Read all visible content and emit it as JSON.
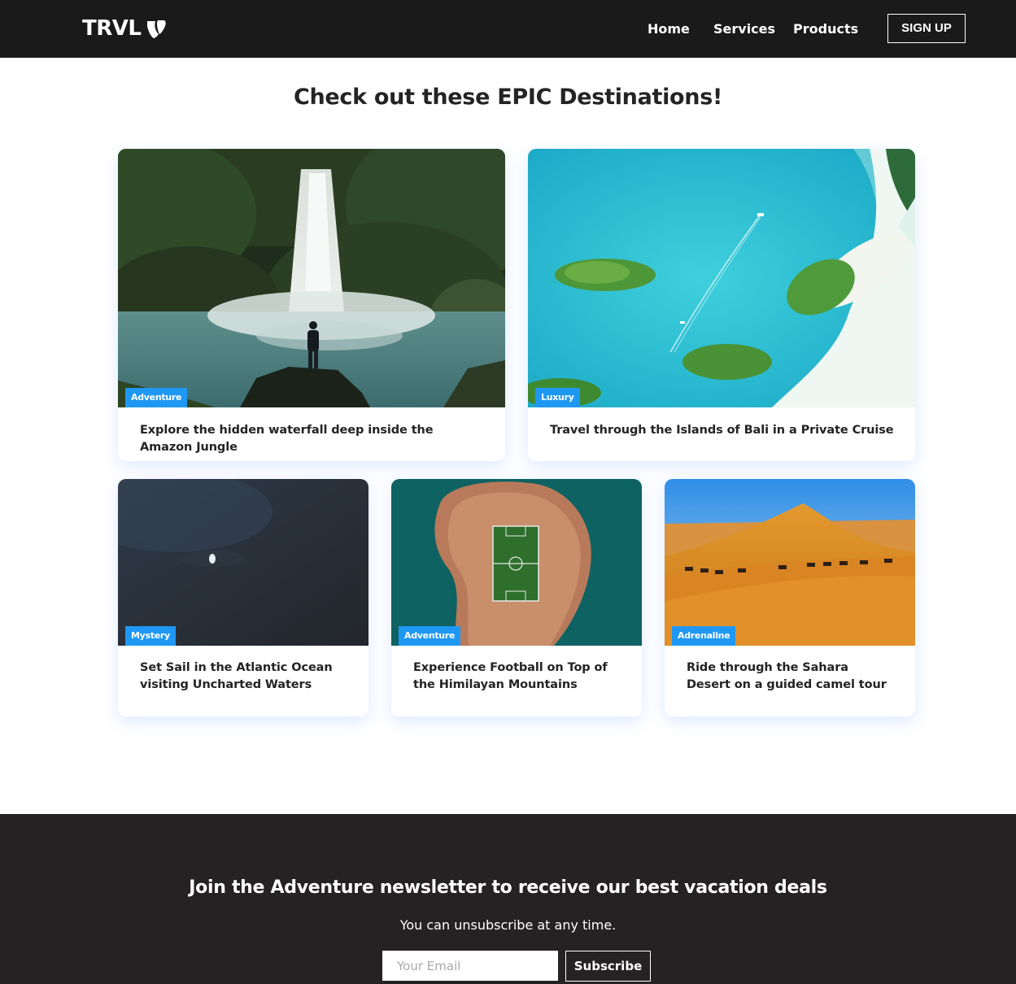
{
  "brand": {
    "name": "TRVL",
    "logo_icon": "typo3-icon"
  },
  "nav": {
    "links": [
      {
        "label": "Home"
      },
      {
        "label": "Services"
      },
      {
        "label": "Products"
      }
    ],
    "signup_label": "SIGN UP"
  },
  "main": {
    "title": "Check out these EPIC Destinations!",
    "cards": [
      {
        "tag": "Adventure",
        "text": "Explore the hidden waterfall deep inside the Amazon Jungle",
        "image": "waterfall-photo"
      },
      {
        "tag": "Luxury",
        "text": "Travel through the Islands of Bali in a Private Cruise",
        "image": "islands-aerial-photo"
      },
      {
        "tag": "Mystery",
        "text": "Set Sail in the Atlantic Ocean visiting Uncharted Waters",
        "image": "ocean-boat-photo"
      },
      {
        "tag": "Adventure",
        "text": "Experience Football on Top of the Himilayan Mountains",
        "image": "island-football-field-photo"
      },
      {
        "tag": "Adrenaline",
        "text": "Ride through the Sahara Desert on a guided camel tour",
        "image": "desert-camels-photo"
      }
    ]
  },
  "footer": {
    "heading": "Join the Adventure newsletter to receive our best vacation deals",
    "subtext": "You can unsubscribe at any time.",
    "email_placeholder": "Your Email",
    "subscribe_label": "Subscribe"
  },
  "colors": {
    "navbar_bg": "#1a1a1a",
    "footer_bg": "#242222",
    "badge_bg": "#1f98f4",
    "text": "#242424"
  }
}
